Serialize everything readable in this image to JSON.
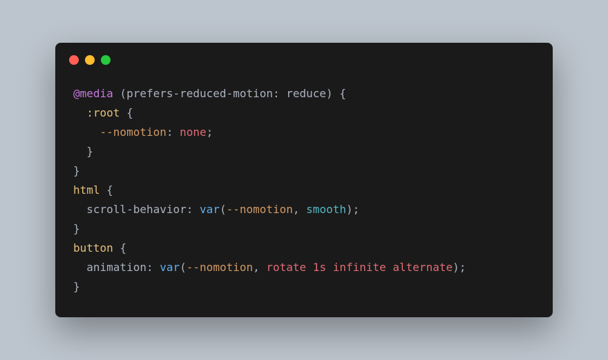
{
  "code": {
    "l1": {
      "at": "@media",
      "cond": " (prefers-reduced-motion: reduce) ",
      "brace": "{"
    },
    "l2": {
      "indent": "  ",
      "sel": ":root",
      "space": " ",
      "brace": "{"
    },
    "l3": {
      "indent": "    ",
      "var": "--nomotion",
      "colon": ": ",
      "val": "none",
      "semi": ";"
    },
    "l4": {
      "indent": "  ",
      "brace": "}"
    },
    "l5": {
      "brace": "}"
    },
    "l6": {
      "sel": "html",
      "space": " ",
      "brace": "{"
    },
    "l7": {
      "indent": "  ",
      "prop": "scroll-behavior",
      "colon": ": ",
      "fn": "var",
      "paren1": "(",
      "arg1": "--nomotion",
      "comma": ", ",
      "arg2": "smooth",
      "paren2": ")",
      "semi": ";"
    },
    "l8": {
      "brace": "}"
    },
    "l9": {
      "sel": "button",
      "space": " ",
      "brace": "{"
    },
    "l10": {
      "indent": "  ",
      "prop": "animation",
      "colon": ": ",
      "fn": "var",
      "paren1": "(",
      "arg1": "--nomotion",
      "comma": ", ",
      "arg2": "rotate 1s infinite alternate",
      "paren2": ")",
      "semi": ";"
    },
    "l11": {
      "brace": "}"
    }
  }
}
